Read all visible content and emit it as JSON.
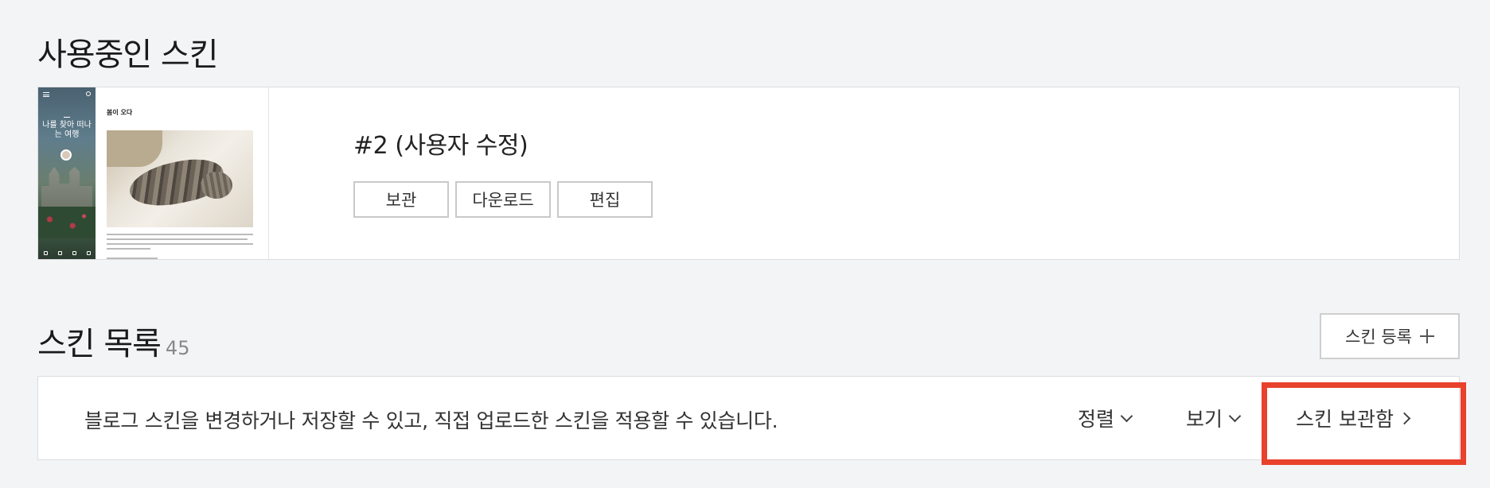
{
  "current_skin": {
    "section_title": "사용중인 스킨",
    "name": "#2 (사용자 수정)",
    "buttons": {
      "keep": "보관",
      "download": "다운로드",
      "edit": "편집"
    },
    "thumbnail": {
      "side_text": "나를 찾아 떠나는 여행",
      "post_title": "봄이 오다"
    }
  },
  "skin_list": {
    "section_title": "스킨 목록",
    "count": "45",
    "register_label": "스킨 등록",
    "description": "블로그 스킨을 변경하거나 저장할 수 있고, 직접 업로드한 스킨을 적용할 수 있습니다.",
    "sort_label": "정렬",
    "view_label": "보기",
    "archive_label": "스킨 보관함"
  },
  "colors": {
    "highlight": "#e8412c",
    "background": "#f3f4f6"
  }
}
